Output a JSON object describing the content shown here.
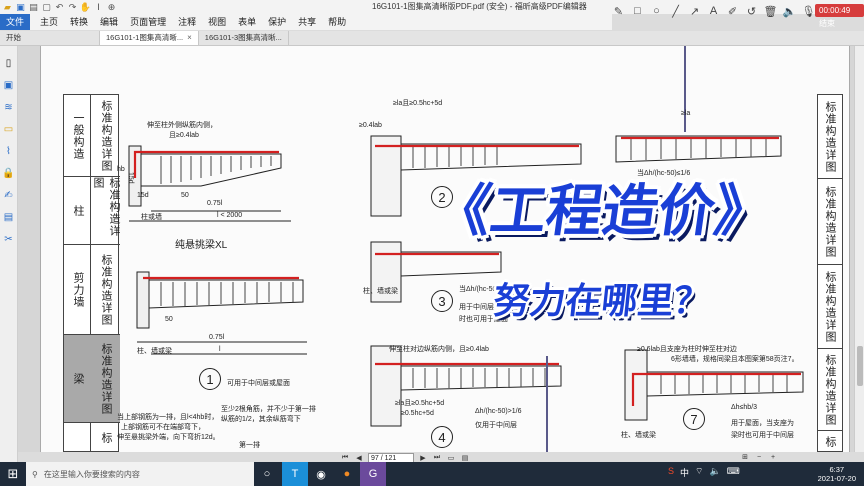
{
  "window": {
    "title": "16G101-1图集高清晰版PDF.pdf (安全) - 福昕高级PDF编辑器",
    "record_badge": "00:00:49 结束",
    "quick_access_icons": [
      "folder-icon",
      "save-icon",
      "print-icon",
      "new-icon",
      "undo-icon",
      "redo-icon",
      "hand-icon",
      "select-icon",
      "zoom-icon"
    ]
  },
  "menu": {
    "items": [
      "文件",
      "主页",
      "转换",
      "编辑",
      "页面管理",
      "注释",
      "视图",
      "表单",
      "保护",
      "共享",
      "帮助"
    ]
  },
  "tabs": [
    {
      "label": "开始"
    },
    {
      "label": "16G101-1图集高清晰..."
    },
    {
      "label": "16G101-3图集高清晰..."
    }
  ],
  "sidebar_right": [
    {
      "text": "标准构造详图"
    },
    {
      "text": "标准构造详图"
    },
    {
      "text": "标准构造详图"
    },
    {
      "text": "标准构造详图"
    },
    {
      "text": "标"
    }
  ],
  "sidebar_left": [
    {
      "text": "一般构造"
    },
    {
      "text": "标准构造详图"
    },
    {
      "text": "柱"
    },
    {
      "text": "标准构造详图"
    },
    {
      "text": "剪力墙"
    },
    {
      "text": "标准构造详图"
    },
    {
      "text": "梁"
    },
    {
      "text": "标准构造详图"
    },
    {
      "text": "标"
    }
  ],
  "drawing": {
    "caption_xl": "纯悬挑梁XL",
    "labels": {
      "l1": "伸至柱外侧纵筋内侧，",
      "l2": "且≥0.4lab",
      "h": "hb",
      "d15": "15d",
      "d15b": "15d",
      "dim50": "50",
      "dim075": "0.75l",
      "dim_lt2000": "l < 2000",
      "col": "柱或墙",
      "col2": "柱、墙或梁",
      "dim50b": "50",
      "dim075b": "0.75l",
      "l_only": "l",
      "note1": "可用于中间层或屋面",
      "note2a": "当上部钢筋为一排，且l<4hb时，",
      "note2b": "上部钢筋可不在端部弯下，",
      "note2c": "伸至悬挑梁外端，向下弯折12d。",
      "note3a": "至少2根角筋，并不少于第一排",
      "note3b": "纵筋的1/2，其余纵筋弯下",
      "note3c": "第一排",
      "top_a": "≥la且≥0.5hc+5d",
      "top_b": "≥0.4lab",
      "mid_a": "当Δh/(hc-50)≤1/6",
      "mid_b": "用于中间层",
      "mid_c": "时也可用于屋面",
      "mid_d": "伸至柱对边纵筋内侧，且≥0.4lab",
      "bot_a": "≥la且≥0.5hc+5d",
      "bot_b": "Δh/(hc-50)>1/6",
      "bot_c": "仅用于中间层",
      "col3": "柱、墙或梁",
      "r_a": "当Δh/(hc-50)≤1/6",
      "r_b": "≥la",
      "r_c": "≥0.6lab且支座为柱时伸至柱对边",
      "r_d": "6形墙墙，规格同梁且本图案第58页注7。",
      "r_e": "Δh≤hb/3",
      "r_f": "用于屋面，当支座为",
      "r_g": "梁时也可用于中间层",
      "r_h": "柱、墙或梁",
      "cross": "≥0.5hc+5d"
    },
    "circled": [
      "1",
      "2",
      "3",
      "4",
      "7"
    ]
  },
  "overlay": {
    "title": "《工程造价》",
    "subtitle": "努力在哪里？"
  },
  "nav": {
    "page_indicator": "97 / 121"
  },
  "taskbar": {
    "search_placeholder": "在这里输入你要搜索的内容",
    "time": "6:37",
    "date": "2021-07-20",
    "ime": "中",
    "apps": [
      "task-view-icon",
      "app-t-icon",
      "browser-icon",
      "app-orange-icon",
      "editor-icon"
    ]
  }
}
